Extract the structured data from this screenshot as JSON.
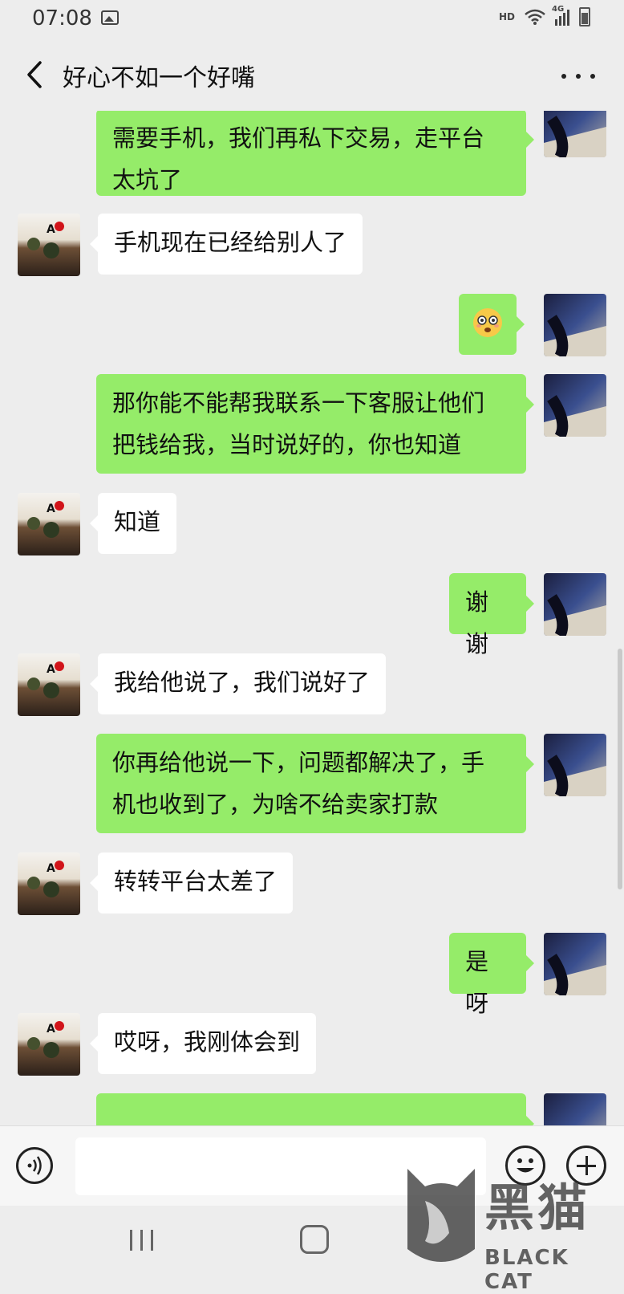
{
  "status_bar": {
    "time": "07:08",
    "hd": "HD",
    "network": "4G",
    "icons": [
      "gallery-icon",
      "wifi-icon",
      "signal-icon",
      "battery-icon"
    ]
  },
  "header": {
    "title": "好心不如一个好嘴",
    "back_icon": "chevron-left-icon",
    "more_icon": "more-icon"
  },
  "messages": [
    {
      "side": "right",
      "text": "需要手机，我们再私下交易，走平台\n太坑了"
    },
    {
      "side": "left",
      "text": "手机现在已经给别人了"
    },
    {
      "side": "right",
      "emoji": "shocked-face-emoji"
    },
    {
      "side": "right",
      "text": "那你能不能帮我联系一下客服让他们\n把钱给我，当时说好的，你也知道"
    },
    {
      "side": "left",
      "text": "知道"
    },
    {
      "side": "right",
      "text": "谢谢"
    },
    {
      "side": "left",
      "text": "我给他说了，我们说好了"
    },
    {
      "side": "right",
      "text": "你再给他说一下，问题都解决了，手\n机也收到了，为啥不给卖家打款"
    },
    {
      "side": "left",
      "text": "转转平台太差了"
    },
    {
      "side": "right",
      "text": "是呀"
    },
    {
      "side": "left",
      "text": "哎呀，我刚体会到"
    }
  ],
  "input_bar": {
    "value": "",
    "voice_icon": "voice-icon",
    "emoji_icon": "emoji-icon",
    "plus_icon": "plus-icon"
  },
  "nav_bar": {
    "recent_icon": "recent-apps-icon",
    "home_icon": "home-icon"
  },
  "watermark": {
    "cn": "黑猫",
    "en": "BLACK CAT"
  },
  "colors": {
    "background": "#ededed",
    "sent_bubble": "#95ec69",
    "received_bubble": "#ffffff"
  }
}
